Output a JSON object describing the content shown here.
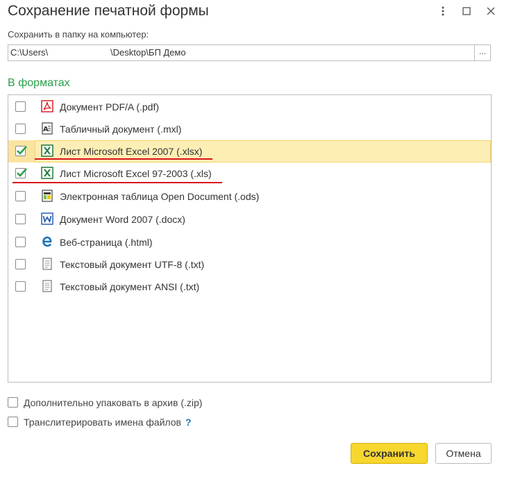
{
  "dialog": {
    "title": "Сохранение печатной формы"
  },
  "folder": {
    "label": "Сохранить в папку на компьютер:",
    "path_part1": "C:\\Users\\",
    "path_part2": "\\Desktop\\БП Демо",
    "browse_label": "..."
  },
  "formats": {
    "title": "В форматах",
    "items": [
      {
        "label": "Документ PDF/A (.pdf)",
        "checked": false,
        "icon": "pdf-icon"
      },
      {
        "label": "Табличный документ (.mxl)",
        "checked": false,
        "icon": "mxl-icon"
      },
      {
        "label": "Лист Microsoft Excel 2007 (.xlsx)",
        "checked": true,
        "icon": "excel-icon"
      },
      {
        "label": "Лист Microsoft Excel 97-2003 (.xls)",
        "checked": true,
        "icon": "excel-icon"
      },
      {
        "label": "Электронная таблица Open Document (.ods)",
        "checked": false,
        "icon": "ods-icon"
      },
      {
        "label": "Документ Word 2007 (.docx)",
        "checked": false,
        "icon": "word-icon"
      },
      {
        "label": "Веб-страница (.html)",
        "checked": false,
        "icon": "html-icon"
      },
      {
        "label": "Текстовый документ UTF-8 (.txt)",
        "checked": false,
        "icon": "txt-icon"
      },
      {
        "label": "Текстовый документ ANSI (.txt)",
        "checked": false,
        "icon": "txt-icon"
      }
    ]
  },
  "options": {
    "zip_label": "Дополнительно упаковать в архив (.zip)",
    "translit_label": "Транслитерировать имена файлов",
    "help_label": "?"
  },
  "buttons": {
    "save": "Сохранить",
    "cancel": "Отмена"
  },
  "colors": {
    "accent_green": "#2aa14a",
    "save_button": "#f7d62e",
    "selection": "#fbe3a0",
    "underline_red": "#d9141b"
  }
}
